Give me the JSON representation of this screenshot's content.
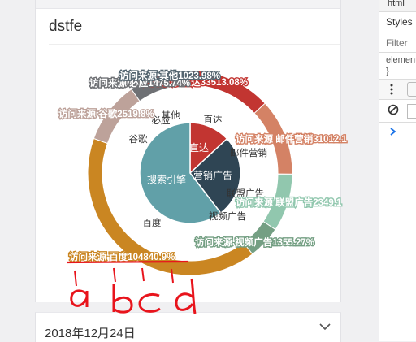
{
  "card": {
    "title": "dstfe"
  },
  "footer": {
    "date": "2018年12月24日"
  },
  "devtools": {
    "tab": "html",
    "styles_tab": "Styles",
    "filter_placeholder": "Filter",
    "element_label": "element",
    "brace": "}"
  },
  "annotations": {
    "letters": [
      "a",
      "b",
      "c",
      "d"
    ]
  },
  "chart_data": {
    "type": "pie",
    "inner": {
      "name": "访问来源",
      "data": [
        {
          "name": "直达",
          "value": 335,
          "color": "#c23531"
        },
        {
          "name": "营销广告",
          "value": 679,
          "color": "#2f4554"
        },
        {
          "name": "搜索引擎",
          "value": 1548,
          "color": "#61a0a8"
        }
      ]
    },
    "outer": {
      "name": "访问来源",
      "data": [
        {
          "name": "直达",
          "value": 335,
          "color": "#c23531",
          "label": "访问来源 直达33513.08%"
        },
        {
          "name": "邮件营销",
          "value": 310,
          "color": "#d48265",
          "label": "访问来源 邮件营销31012.1"
        },
        {
          "name": "联盟广告",
          "value": 234,
          "color": "#91c7ae",
          "label": "访问来源 联盟广告2349.1"
        },
        {
          "name": "视频广告",
          "value": 135,
          "color": "#749f83",
          "label": "访问来源 视频广告1355.27%"
        },
        {
          "name": "百度",
          "value": 1048,
          "color": "#ca8622",
          "label": "访问来源 百度104840.9%"
        },
        {
          "name": "谷歌",
          "value": 251,
          "color": "#bda29a",
          "label": "访问来源 谷歌2519.8%"
        },
        {
          "name": "必应",
          "value": 147,
          "color": "#6e7074",
          "label": "访问来源 必应1475.74%"
        },
        {
          "name": "其他",
          "value": 102,
          "color": "#546570",
          "label": "访问来源 其他1023.98%"
        }
      ]
    }
  }
}
